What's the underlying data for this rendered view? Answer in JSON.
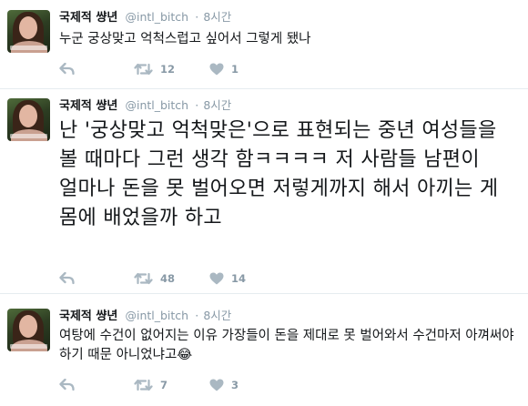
{
  "tweets": [
    {
      "author": "국제적 썅년",
      "handle": "@intl_bitch",
      "separator": "·",
      "time": "8시간",
      "text": "누군 궁상맞고 억척스럽고 싶어서 그렇게 됐나",
      "retweets": "12",
      "likes": "1"
    },
    {
      "author": "국제적 썅년",
      "handle": "@intl_bitch",
      "separator": "·",
      "time": "8시간",
      "text": "난 '궁상맞고 억척맞은'으로 표현되는 중년 여성들을 볼 때마다 그런 생각 함ㅋㅋㅋㅋ 저 사람들 남편이 얼마나 돈을 못 벌어오면 저렇게까지 해서 아끼는 게 몸에 배었을까 하고",
      "retweets": "48",
      "likes": "14"
    },
    {
      "author": "국제적 썅년",
      "handle": "@intl_bitch",
      "separator": "·",
      "time": "8시간",
      "text": "여탕에 수건이 없어지는 이유 가장들이 돈을 제대로 못 벌어와서 수건마저 아껴써야 하기 때문 아니었냐고😂",
      "retweets": "7",
      "likes": "3"
    }
  ],
  "icons": {
    "reply": "reply-icon",
    "retweet": "retweet-icon",
    "like": "heart-icon"
  },
  "colors": {
    "text": "#14171a",
    "meta": "#8899a6",
    "icon": "#aab8c2",
    "divider": "#e6ecf0"
  }
}
